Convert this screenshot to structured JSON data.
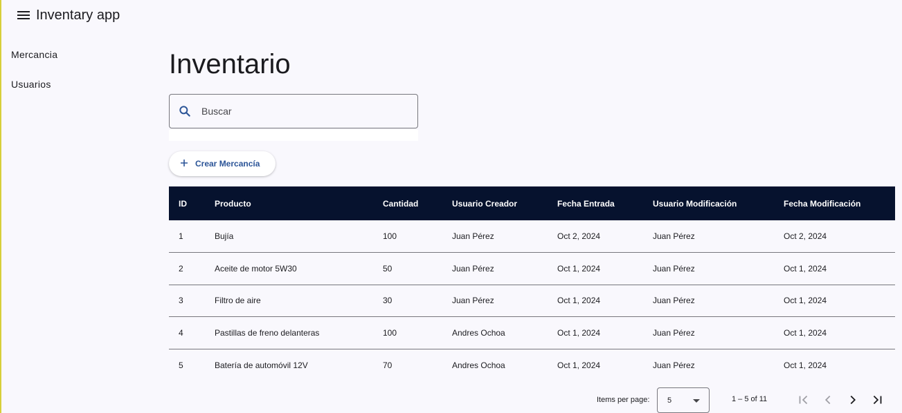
{
  "app": {
    "title": "Inventary app"
  },
  "sidebar": {
    "items": [
      {
        "label": "Mercancia"
      },
      {
        "label": "Usuarios"
      }
    ]
  },
  "page": {
    "title": "Inventario"
  },
  "search": {
    "placeholder": "Buscar",
    "value": ""
  },
  "actions": {
    "create_label": "Crear Mercancía"
  },
  "table": {
    "headers": [
      "ID",
      "Producto",
      "Cantidad",
      "Usuario Creador",
      "Fecha Entrada",
      "Usuario Modificación",
      "Fecha Modificación"
    ],
    "rows": [
      [
        "1",
        "Bujía",
        "100",
        "Juan Pérez",
        "Oct 2, 2024",
        "Juan Pérez",
        "Oct 2, 2024"
      ],
      [
        "2",
        "Aceite de motor 5W30",
        "50",
        "Juan Pérez",
        "Oct 1, 2024",
        "Juan Pérez",
        "Oct 1, 2024"
      ],
      [
        "3",
        "Filtro de aire",
        "30",
        "Juan Pérez",
        "Oct 1, 2024",
        "Juan Pérez",
        "Oct 1, 2024"
      ],
      [
        "4",
        "Pastillas de freno delanteras",
        "100",
        "Andres Ochoa",
        "Oct 1, 2024",
        "Juan Pérez",
        "Oct 1, 2024"
      ],
      [
        "5",
        "Batería de automóvil 12V",
        "70",
        "Andres Ochoa",
        "Oct 1, 2024",
        "Juan Pérez",
        "Oct 1, 2024"
      ]
    ]
  },
  "paginator": {
    "items_per_page_label": "Items per page:",
    "page_size": "5",
    "range_label": "1 – 5 of 11"
  },
  "colors": {
    "header_bg": "#06122e",
    "accent": "#2b5497",
    "background": "#f9f8fd"
  },
  "icons": [
    "menu-icon",
    "search-icon",
    "plus-icon",
    "first-page-icon",
    "prev-page-icon",
    "next-page-icon",
    "last-page-icon"
  ]
}
